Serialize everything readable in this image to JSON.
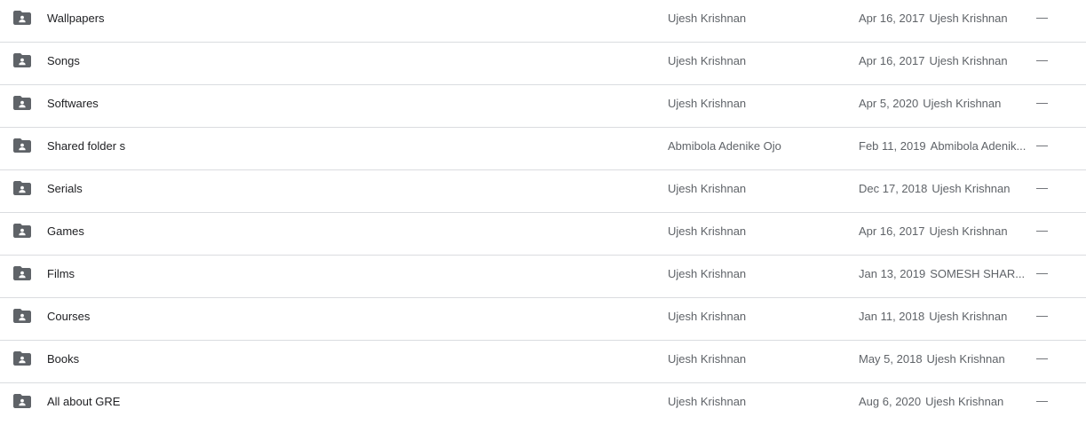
{
  "icons": {
    "row_icon": "shared-folder-icon"
  },
  "rows": [
    {
      "name": "Wallpapers",
      "owner": "Ujesh Krishnan",
      "modified_date": "Apr 16, 2017",
      "modified_by": "Ujesh Krishnan",
      "size": "—"
    },
    {
      "name": "Songs",
      "owner": "Ujesh Krishnan",
      "modified_date": "Apr 16, 2017",
      "modified_by": "Ujesh Krishnan",
      "size": "—"
    },
    {
      "name": "Softwares",
      "owner": "Ujesh Krishnan",
      "modified_date": "Apr 5, 2020",
      "modified_by": "Ujesh Krishnan",
      "size": "—"
    },
    {
      "name": "Shared folder s",
      "owner": "Abmibola Adenike Ojo",
      "modified_date": "Feb 11, 2019",
      "modified_by": "Abmibola Adenik...",
      "size": "—"
    },
    {
      "name": "Serials",
      "owner": "Ujesh Krishnan",
      "modified_date": "Dec 17, 2018",
      "modified_by": "Ujesh Krishnan",
      "size": "—"
    },
    {
      "name": "Games",
      "owner": "Ujesh Krishnan",
      "modified_date": "Apr 16, 2017",
      "modified_by": "Ujesh Krishnan",
      "size": "—"
    },
    {
      "name": "Films",
      "owner": "Ujesh Krishnan",
      "modified_date": "Jan 13, 2019",
      "modified_by": "SOMESH SHAR...",
      "size": "—"
    },
    {
      "name": "Courses",
      "owner": "Ujesh Krishnan",
      "modified_date": "Jan 11, 2018",
      "modified_by": "Ujesh Krishnan",
      "size": "—"
    },
    {
      "name": "Books",
      "owner": "Ujesh Krishnan",
      "modified_date": "May 5, 2018",
      "modified_by": "Ujesh Krishnan",
      "size": "—"
    },
    {
      "name": "All about GRE",
      "owner": "Ujesh Krishnan",
      "modified_date": "Aug 6, 2020",
      "modified_by": "Ujesh Krishnan",
      "size": "—"
    }
  ],
  "colors": {
    "text_primary": "#202124",
    "text_secondary": "#5f6368",
    "icon": "#5f6368",
    "divider": "#dadce0"
  }
}
